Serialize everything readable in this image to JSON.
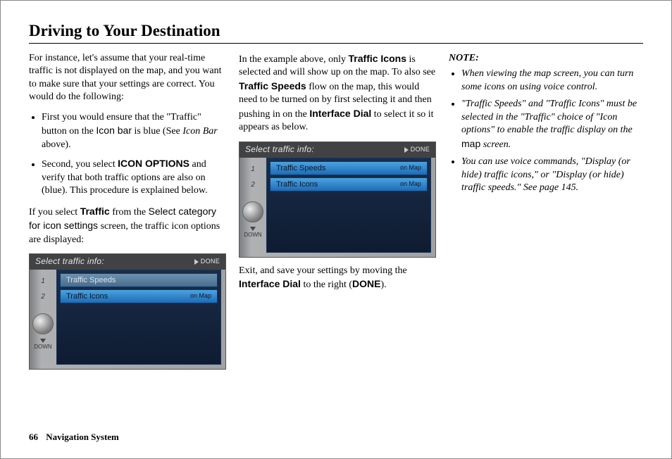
{
  "title": "Driving to Your Destination",
  "col1": {
    "p1": "For instance, let's assume that your real-time traffic is not displayed on the map, and you want to make sure that your settings are correct. You would do the following:",
    "b1_a": "First you would ensure that the \"Traffic\" button on the ",
    "b1_iconbar": "Icon bar",
    "b1_b": " is blue (See ",
    "b1_iconbar2": "Icon Bar",
    "b1_c": " above).",
    "b2_a": "Second, you select ",
    "b2_iconopt": "ICON OPTIONS",
    "b2_b": " and verify that both traffic options are also on (blue). This procedure is explained below.",
    "p2_a": "If you select ",
    "p2_traffic": "Traffic",
    "p2_b": " from the ",
    "p2_select": "Select category for icon settings",
    "p2_c": " screen, the traffic icon options are displayed:"
  },
  "ui1": {
    "header": "Select traffic info:",
    "done": "DONE",
    "row1": "Traffic Speeds",
    "row2": "Traffic Icons",
    "on": "on Map",
    "n1": "1",
    "n2": "2",
    "down": "DOWN"
  },
  "col2": {
    "p1_a": "In the example above, only ",
    "p1_ti": "Traffic Icons",
    "p1_b": " is selected and will show up on the map. To also see ",
    "p1_ts": "Traffic Speeds",
    "p1_c": " flow on the map, this would need to be turned on by first selecting it and then pushing in on the ",
    "p1_id": "Interface Dial",
    "p1_d": " to select it so it appears as below.",
    "p2_a": "Exit, and save your settings by moving the ",
    "p2_id": "Interface Dial",
    "p2_b": " to the right (",
    "p2_done": "DONE",
    "p2_c": ")."
  },
  "ui2": {
    "header": "Select traffic info:",
    "done": "DONE",
    "row1": "Traffic Speeds",
    "row2": "Traffic Icons",
    "on": "on Map",
    "n1": "1",
    "n2": "2",
    "down": "DOWN"
  },
  "col3": {
    "note": "NOTE:",
    "n1": "When viewing the map screen, you can turn some icons on using voice control.",
    "n2_a": "\"Traffic Speeds\" and \"Traffic Icons\" must be selected in the \"Traffic\" choice of \"Icon options\" to enable the traffic display on the ",
    "n2_map": "map",
    "n2_b": " screen.",
    "n3": "You can use voice commands, \"Display (or hide) traffic icons,\" or \"Display (or hide) traffic speeds.\" See page 145."
  },
  "footer": {
    "page": "66",
    "label": "Navigation System"
  }
}
